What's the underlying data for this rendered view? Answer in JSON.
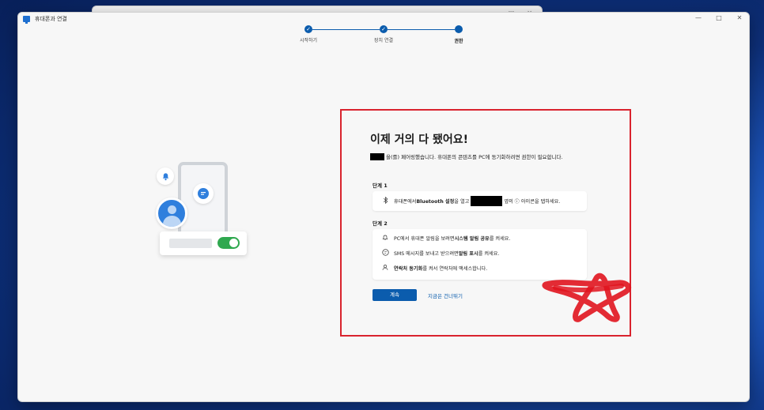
{
  "window": {
    "title": "휴대폰과 연결",
    "controls": [
      "—",
      "□",
      "✕"
    ]
  },
  "stepper": {
    "steps": [
      {
        "label": "시작하기",
        "state": "done",
        "icon": "check-icon"
      },
      {
        "label": "장치 연결",
        "state": "done",
        "icon": "check-icon"
      },
      {
        "label": "권한",
        "state": "current",
        "icon": "dot-icon"
      }
    ]
  },
  "content": {
    "heading": "이제 거의 다 됐어요!",
    "intro_suffix": "을(를) 페어링했습니다. 휴대폰의 콘텐츠를 PC에 동기화하려면 권한이 필요합니다.",
    "step1": {
      "title": "단계 1",
      "row": {
        "icon": "bluetooth-icon",
        "pre": "휴대폰에서 ",
        "bold": "Bluetooth 설정",
        "mid": "을 열고 ",
        "post": "옆의 ⓘ 아이콘을 탭하세요."
      }
    },
    "step2": {
      "title": "단계 2",
      "rows": [
        {
          "icon": "bell-icon",
          "pre": "PC에서 휴대폰 알림을 보려면 ",
          "bold": "시스템 알림 공유",
          "post": "를 켜세요."
        },
        {
          "icon": "message-icon",
          "pre": "SMS 메시지를 보내고 받으려면 ",
          "bold": "알림 표시",
          "post": "를 켜세요."
        },
        {
          "icon": "person-icon",
          "pre": "",
          "bold": "연락처 동기화",
          "post": "를 켜서 연락처에 액세스합니다."
        }
      ]
    },
    "continue_label": "계속",
    "skip_label": "지금은 건너뛰기"
  },
  "colors": {
    "accent": "#0b5cad",
    "highlight": "#d9232e",
    "scribble": "#e0141e",
    "toggle_on": "#2fa84f"
  }
}
